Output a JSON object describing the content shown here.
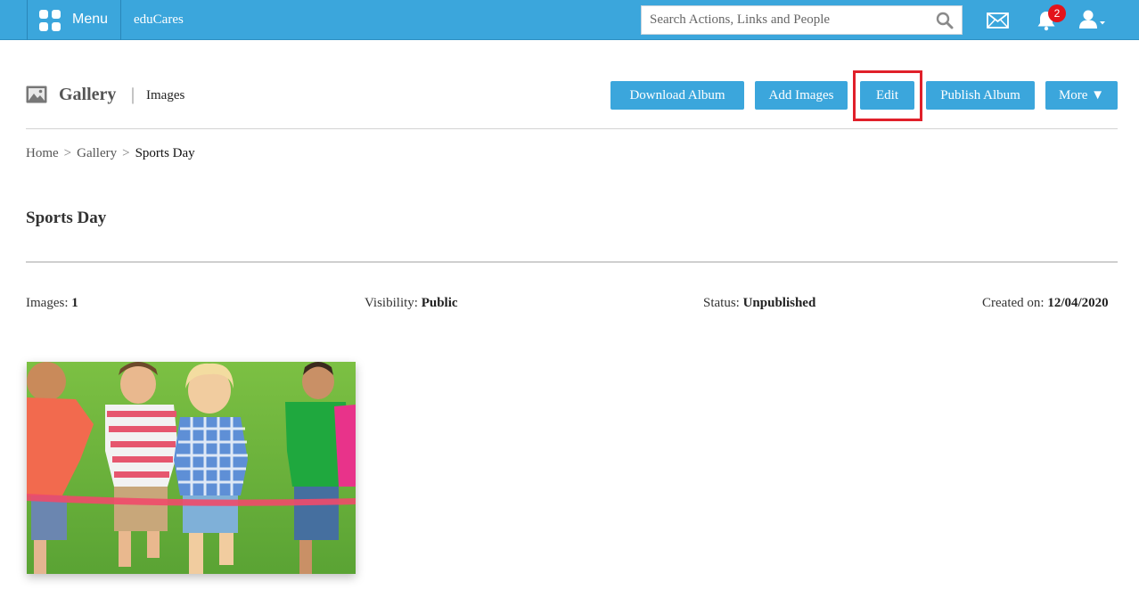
{
  "topbar": {
    "menu_label": "Menu",
    "brand": "eduCares",
    "search_placeholder": "Search Actions, Links and People",
    "notification_count": "2",
    "accent_color": "#3ba6dc"
  },
  "header": {
    "title": "Gallery",
    "separator": "|",
    "subtitle": "Images",
    "icon": "gallery-icon"
  },
  "actions": {
    "download": "Download Album",
    "add": "Add Images",
    "edit": "Edit",
    "publish": "Publish Album",
    "more": "More ▼"
  },
  "breadcrumb": {
    "items": [
      "Home",
      "Gallery",
      "Sports Day"
    ],
    "separator": ">"
  },
  "album": {
    "title": "Sports Day",
    "images_label": "Images:",
    "images_value": "1",
    "visibility_label": "Visibility:",
    "visibility_value": "Public",
    "status_label": "Status:",
    "status_value": "Unpublished",
    "created_label": "Created on:",
    "created_value": "12/04/2020"
  }
}
